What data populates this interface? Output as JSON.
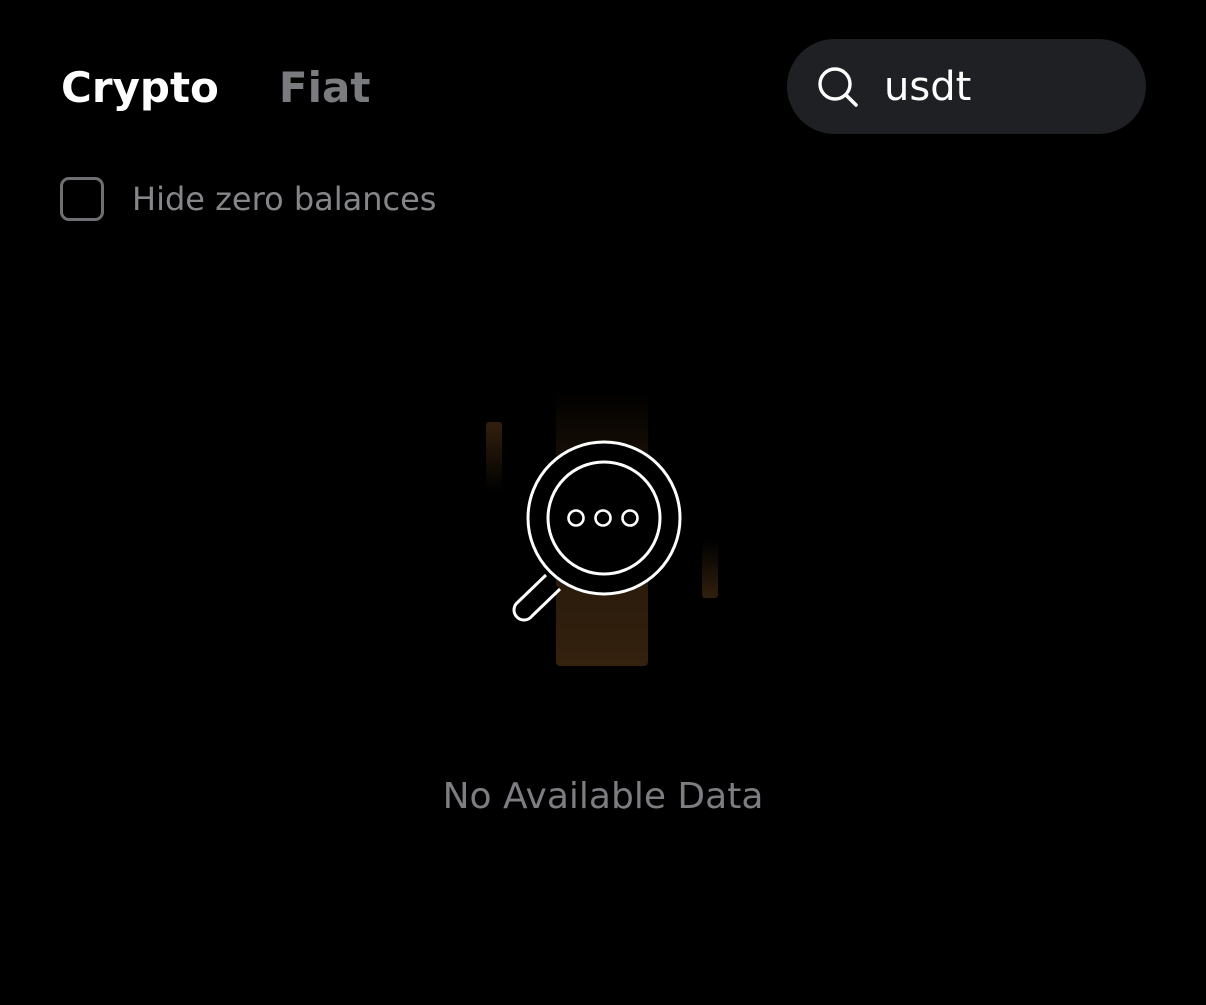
{
  "tabs": [
    {
      "label": "Crypto",
      "active": true
    },
    {
      "label": "Fiat",
      "active": false
    }
  ],
  "search": {
    "value": "usdt",
    "placeholder": "Search",
    "icon": "search-icon"
  },
  "filter": {
    "hide_zero_label": "Hide zero balances",
    "checked": false
  },
  "empty_state": {
    "message": "No Available Data",
    "icon": "magnifier-empty-icon"
  },
  "colors": {
    "background": "#000000",
    "search_bg": "#1f2023",
    "active_tab": "#ffffff",
    "inactive_tab": "#7a7b7e",
    "muted_text": "#7c7d81",
    "accent_glow": "#3a2510"
  }
}
